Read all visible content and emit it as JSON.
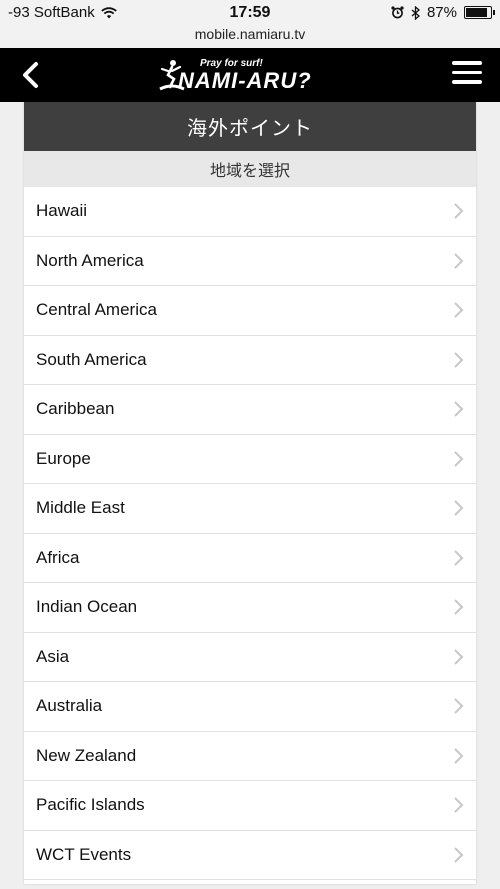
{
  "status_bar": {
    "carrier": "-93 SoftBank",
    "time": "17:59",
    "battery": "87%",
    "battery_level": 0.87
  },
  "url_bar": {
    "url": "mobile.namiaru.tv"
  },
  "nav": {
    "logo_tagline": "Pray for surf!",
    "logo_text": "NAMI-ARU?"
  },
  "panel": {
    "title": "海外ポイント",
    "subtitle": "地域を選択"
  },
  "regions": [
    "Hawaii",
    "North America",
    "Central America",
    "South America",
    "Caribbean",
    "Europe",
    "Middle East",
    "Africa",
    "Indian Ocean",
    "Asia",
    "Australia",
    "New Zealand",
    "Pacific Islands",
    "WCT Events"
  ],
  "colors": {
    "navbar": "#000000",
    "panel_title_bg": "#3f3f3f",
    "chevron": "#c7c7cc"
  }
}
